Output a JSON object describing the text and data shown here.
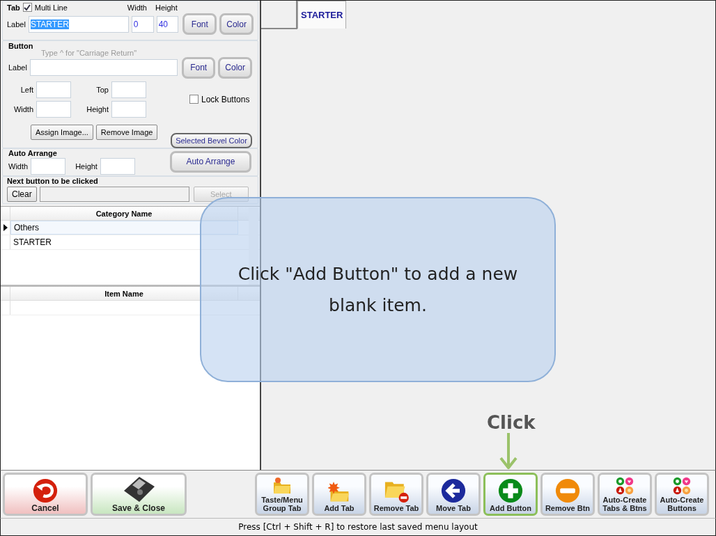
{
  "tab_section": {
    "title": "Tab",
    "multi_line": {
      "label": "Multi Line",
      "checked": true
    },
    "label": "Label",
    "value": "STARTER",
    "value_selected": true,
    "width": {
      "label": "Width",
      "value": "0"
    },
    "height": {
      "label": "Height",
      "value": "40"
    },
    "buttons": [
      "Font",
      "Color"
    ]
  },
  "button_section": {
    "title": "Button",
    "hint": "Type ^ for \"Carriage Return\"",
    "label": "Label",
    "buttons": [
      "Font",
      "Color"
    ],
    "fields": [
      {
        "label": "Left"
      },
      {
        "label": "Top"
      },
      {
        "label": "Width"
      },
      {
        "label": "Height"
      }
    ],
    "lock_buttons": {
      "label": "Lock Buttons",
      "checked": false
    },
    "image_buttons": [
      "Assign Image...",
      "Remove Image"
    ],
    "bevel_button": "Selected Bevel Color"
  },
  "auto_arrange": {
    "title": "Auto Arrange",
    "width_label": "Width",
    "height_label": "Height",
    "button": "Auto Arrange"
  },
  "next_button": {
    "title": "Next button to be clicked",
    "clear": "Clear",
    "select": {
      "label": "Select",
      "disabled": true
    }
  },
  "category_grid": {
    "column": "Category Name",
    "rows": [
      {
        "name": "Others",
        "selected": true
      },
      {
        "name": "STARTER",
        "selected": false
      }
    ]
  },
  "item_grid": {
    "column": "Item Name"
  },
  "canvas": {
    "tabs": [
      {
        "label": "STARTER",
        "selected": true
      }
    ]
  },
  "callout": {
    "text": "Click \"Add Button\" to add a new blank item.",
    "click_label": "Click"
  },
  "toolbar": [
    {
      "label": "Cancel",
      "kind": "undo",
      "highlighted": false
    },
    {
      "label": "Save & Close",
      "kind": "disk",
      "highlighted": false
    },
    {
      "label": "Taste/Menu Group Tab",
      "kind": "folder",
      "highlighted": false
    },
    {
      "label": "Add Tab",
      "kind": "folder-star",
      "highlighted": false
    },
    {
      "label": "Remove Tab",
      "kind": "folder-minus",
      "highlighted": false
    },
    {
      "label": "Move Tab",
      "kind": "back",
      "highlighted": false
    },
    {
      "label": "Add Button",
      "kind": "plus",
      "highlighted": true
    },
    {
      "label": "Remove Btn",
      "kind": "minus",
      "highlighted": false
    },
    {
      "label": "Auto-Create Tabs & Btns",
      "kind": "tokens",
      "highlighted": false
    },
    {
      "label": "Auto-Create Buttons",
      "kind": "tokens",
      "highlighted": false
    }
  ],
  "status_bar": "Press [Ctrl + Shift + R] to restore last saved menu layout"
}
